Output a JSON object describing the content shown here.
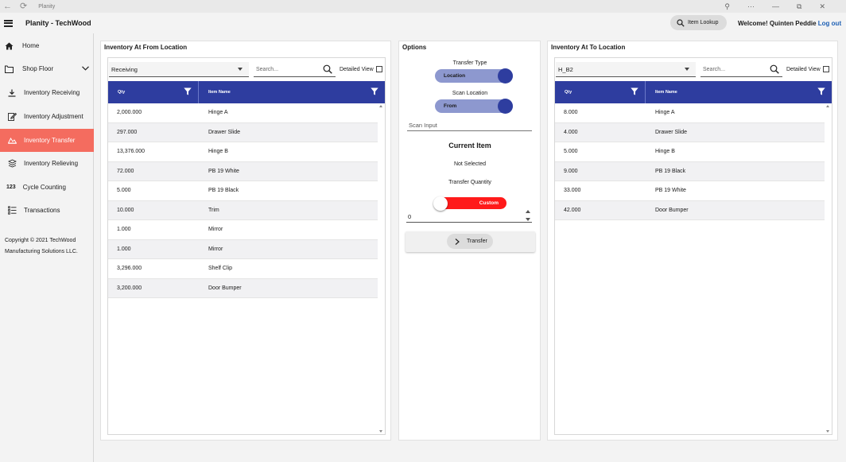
{
  "window": {
    "title": "Planity"
  },
  "app": {
    "title": "Planity - TechWood"
  },
  "header": {
    "lookup_label": "Item Lookup",
    "welcome_text": "Welcome! Quinten Peddie",
    "logout_label": "Log out"
  },
  "sidebar": {
    "items": [
      {
        "label": "Home",
        "icon": "home-icon"
      },
      {
        "label": "Shop Floor",
        "icon": "shop-floor-icon"
      },
      {
        "label": "Inventory Receiving",
        "icon": "download-icon"
      },
      {
        "label": "Inventory Adjustment",
        "icon": "edit-icon"
      },
      {
        "label": "Inventory Transfer",
        "icon": "transfer-icon"
      },
      {
        "label": "Inventory Relieving",
        "icon": "relieving-icon"
      },
      {
        "label": "Cycle Counting",
        "icon": "counter-icon",
        "glyph": "123"
      },
      {
        "label": "Transactions",
        "icon": "list-icon"
      }
    ],
    "copyright": "Copyright © 2021 TechWood Manufacturing Solutions LLC."
  },
  "from_panel": {
    "title": "Inventory At From Location",
    "location": "Receiving",
    "search_placeholder": "Search...",
    "detailed_label": "Detailed View",
    "col_qty": "Qty",
    "col_item": "Item Name",
    "rows": [
      {
        "qty": "2,000.000",
        "item": "Hinge A"
      },
      {
        "qty": "297.000",
        "item": "Drawer Slide"
      },
      {
        "qty": "13,376.000",
        "item": "Hinge B"
      },
      {
        "qty": "72.000",
        "item": "PB 19 White"
      },
      {
        "qty": "5.000",
        "item": "PB 19 Black"
      },
      {
        "qty": "10.000",
        "item": "Trim"
      },
      {
        "qty": "1.000",
        "item": "Mirror"
      },
      {
        "qty": "1.000",
        "item": "Mirror"
      },
      {
        "qty": "3,296.000",
        "item": "Shelf Clip"
      },
      {
        "qty": "3,200.000",
        "item": "Door Bumper"
      }
    ]
  },
  "options": {
    "title": "Options",
    "transfer_type_label": "Transfer Type",
    "transfer_type_value": "Location",
    "scan_location_label": "Scan Location",
    "scan_location_value": "From",
    "scan_placeholder": "Scan Input",
    "current_item_label": "Current Item",
    "current_item_value": "Not Selected",
    "transfer_qty_label": "Transfer Quantity",
    "qty_mode": "Custom",
    "qty_value": "0",
    "transfer_button": "Transfer"
  },
  "to_panel": {
    "title": "Inventory At To Location",
    "location": "H_B2",
    "search_placeholder": "Search...",
    "detailed_label": "Detailed View",
    "col_qty": "Qty",
    "col_item": "Item Name",
    "rows": [
      {
        "qty": "8.000",
        "item": "Hinge A"
      },
      {
        "qty": "4.000",
        "item": "Drawer Slide"
      },
      {
        "qty": "5.000",
        "item": "Hinge B"
      },
      {
        "qty": "9.000",
        "item": "PB 19 Black"
      },
      {
        "qty": "33.000",
        "item": "PB 19 White"
      },
      {
        "qty": "42.000",
        "item": "Door Bumper"
      }
    ]
  },
  "colors": {
    "accent": "#2e3d9f",
    "active_nav": "#f46c5f",
    "custom_toggle": "#ff1a1a",
    "link": "#1d5fb4"
  }
}
